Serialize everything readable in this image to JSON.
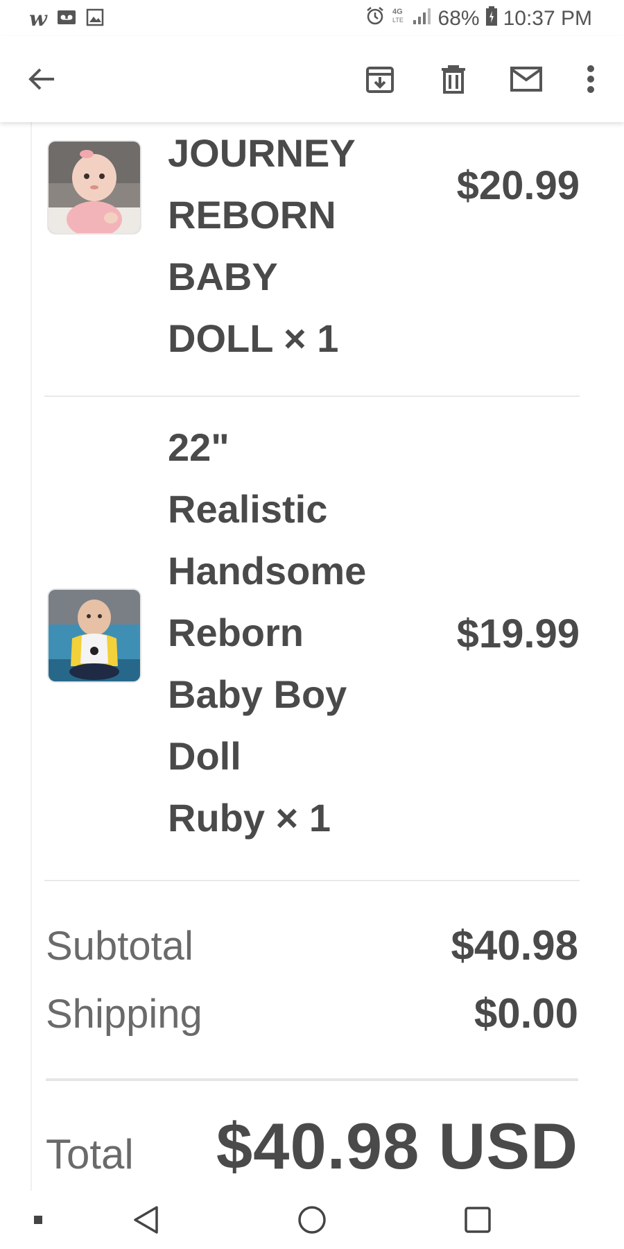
{
  "status_bar": {
    "left_icons": [
      "wish-icon",
      "voicemail-icon",
      "image-icon"
    ],
    "wish_glyph": "w",
    "battery": "68%",
    "time": "10:37 PM",
    "network": "4G LTE"
  },
  "app_bar": {
    "actions": [
      "back-arrow-icon",
      "archive-icon",
      "delete-icon",
      "mark-unread-icon",
      "more-vert-icon"
    ]
  },
  "order": {
    "items": [
      {
        "title": "JOURNEY\nREBORN\nBABY\nDOLL × 1",
        "price": "$20.99"
      },
      {
        "title": "22\"\nRealistic\nHandsome\nReborn\nBaby Boy\nDoll\nRuby × 1",
        "price": "$19.99"
      }
    ],
    "subtotal_label": "Subtotal",
    "subtotal_value": "$40.98",
    "shipping_label": "Shipping",
    "shipping_value": "$0.00",
    "total_label": "Total",
    "total_value": "$40.98 USD"
  },
  "colors": {
    "text": "#4a4a4a",
    "muted": "#6a6a6a",
    "icon": "#555555"
  }
}
